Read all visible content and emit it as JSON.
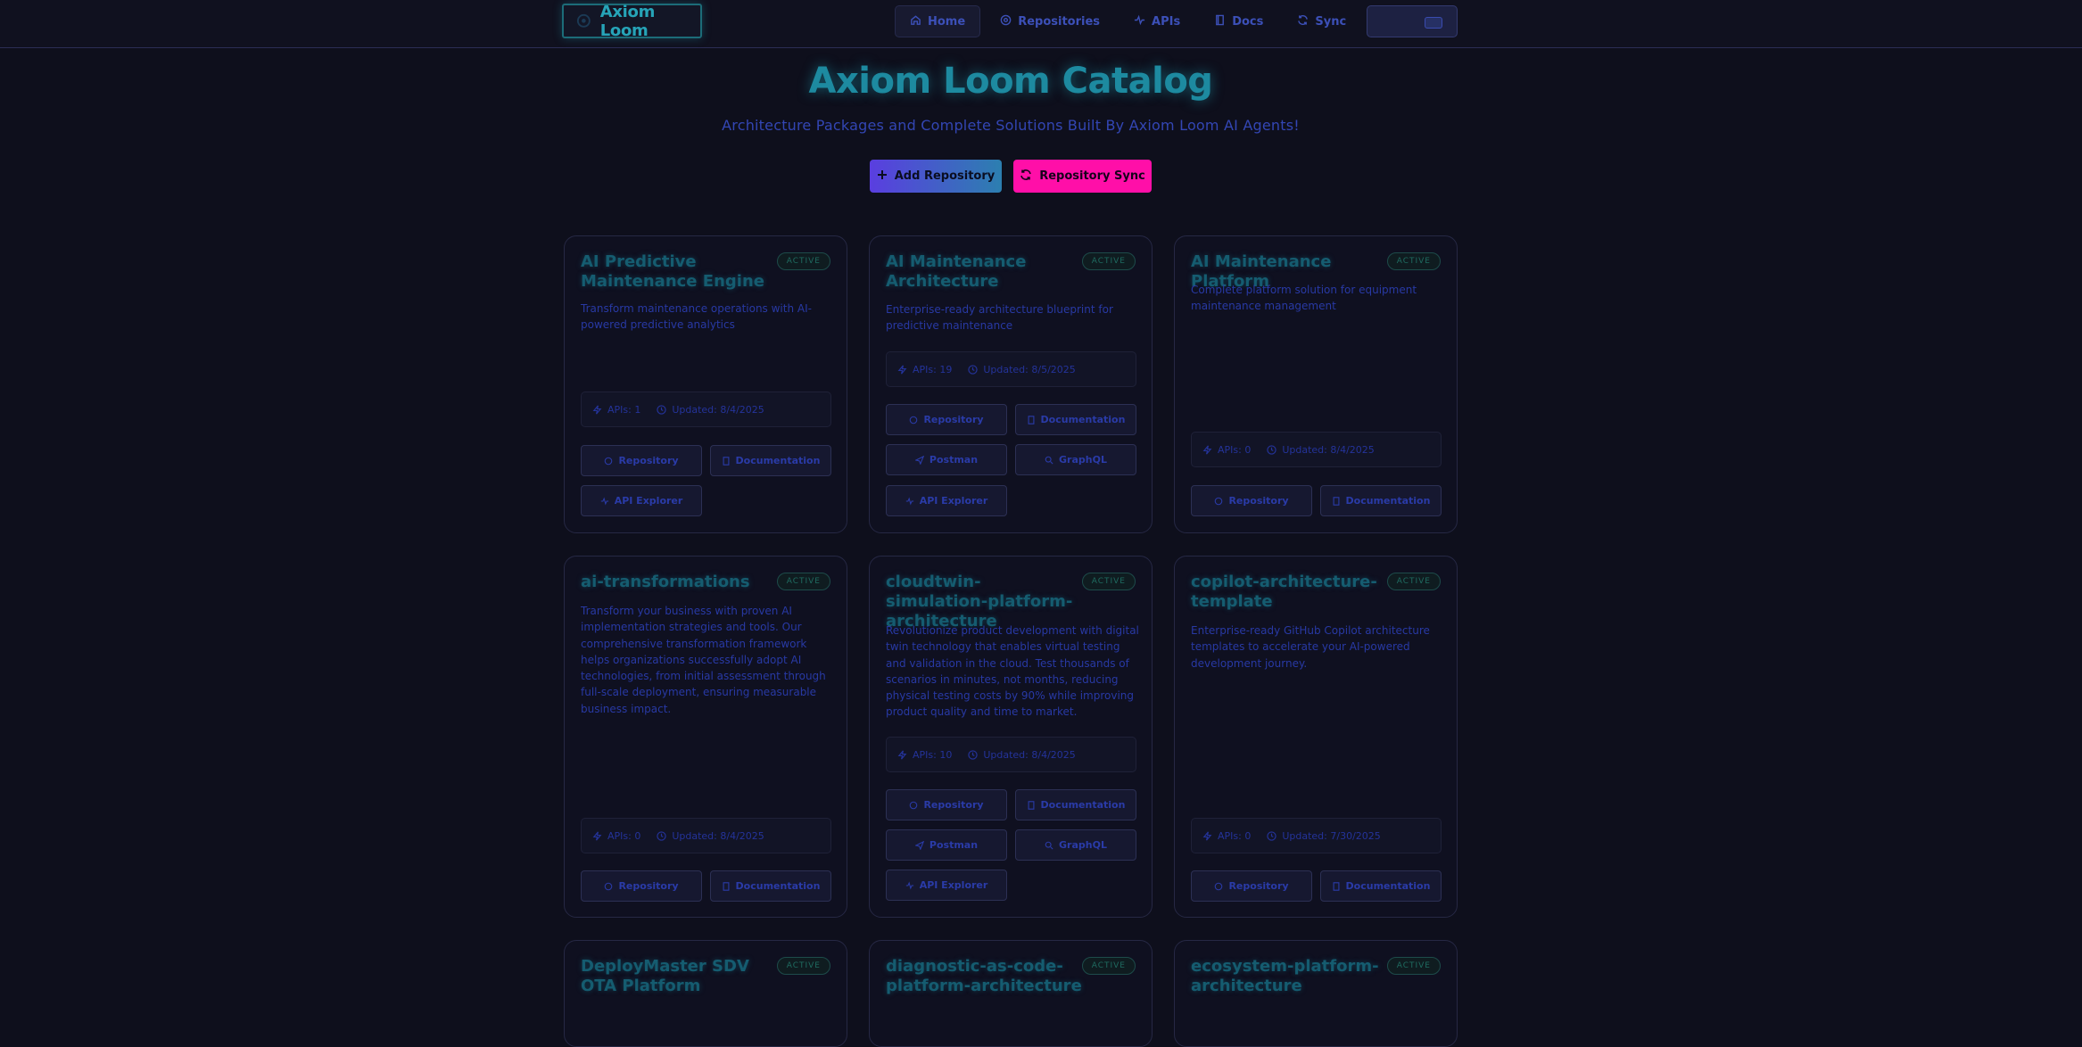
{
  "header": {
    "brand": "Axiom Loom",
    "nav": [
      {
        "label": "Home",
        "icon": "home-icon",
        "active": true
      },
      {
        "label": "Repositories",
        "icon": "repository-icon"
      },
      {
        "label": "APIs",
        "icon": "activity-icon"
      },
      {
        "label": "Docs",
        "icon": "book-icon"
      },
      {
        "label": "Sync",
        "icon": "refresh-icon"
      }
    ]
  },
  "hero": {
    "title": "Axiom Loom Catalog",
    "subtitle": "Architecture Packages and Complete Solutions Built By Axiom Loom AI Agents!",
    "add_label": "Add Repository",
    "sync_label": "Repository Sync"
  },
  "cards": [
    {
      "title": "AI Predictive Maintenance Engine",
      "status": "ACTIVE",
      "description": "Transform maintenance operations with AI-powered predictive analytics",
      "apis": "APIs: 1",
      "updated": "Updated: 8/4/2025",
      "buttons": [
        "Repository",
        "Documentation",
        "API Explorer"
      ]
    },
    {
      "title": "AI Maintenance Architecture",
      "status": "ACTIVE",
      "description": "Enterprise-ready architecture blueprint for predictive maintenance",
      "apis": "APIs: 19",
      "updated": "Updated: 8/5/2025",
      "buttons": [
        "Repository",
        "Documentation",
        "Postman",
        "GraphQL",
        "API Explorer"
      ]
    },
    {
      "title": "AI Maintenance Platform",
      "status": "ACTIVE",
      "description": "Complete platform solution for equipment maintenance management",
      "apis": "APIs: 0",
      "updated": "Updated: 8/4/2025",
      "buttons": [
        "Repository",
        "Documentation"
      ]
    },
    {
      "title": "ai-transformations",
      "status": "ACTIVE",
      "description": "Transform your business with proven AI implementation strategies and tools. Our comprehensive transformation framework helps organizations successfully adopt AI technologies, from initial assessment through full-scale deployment, ensuring measurable business impact.",
      "apis": "APIs: 0",
      "updated": "Updated: 8/4/2025",
      "buttons": [
        "Repository",
        "Documentation"
      ]
    },
    {
      "title": "cloudtwin-simulation-platform-architecture",
      "status": "ACTIVE",
      "description": "Revolutionize product development with digital twin technology that enables virtual testing and validation in the cloud. Test thousands of scenarios in minutes, not months, reducing physical testing costs by 90% while improving product quality and time to market.",
      "apis": "APIs: 10",
      "updated": "Updated: 8/4/2025",
      "buttons": [
        "Repository",
        "Documentation",
        "Postman",
        "GraphQL",
        "API Explorer"
      ]
    },
    {
      "title": "copilot-architecture-template",
      "status": "ACTIVE",
      "description": "Enterprise-ready GitHub Copilot architecture templates to accelerate your AI-powered development journey.",
      "apis": "APIs: 0",
      "updated": "Updated: 7/30/2025",
      "buttons": [
        "Repository",
        "Documentation"
      ]
    },
    {
      "title": "DeployMaster SDV OTA Platform",
      "status": "ACTIVE"
    },
    {
      "title": "diagnostic-as-code-platform-architecture",
      "status": "ACTIVE"
    },
    {
      "title": "ecosystem-platform-architecture",
      "status": "ACTIVE"
    }
  ]
}
